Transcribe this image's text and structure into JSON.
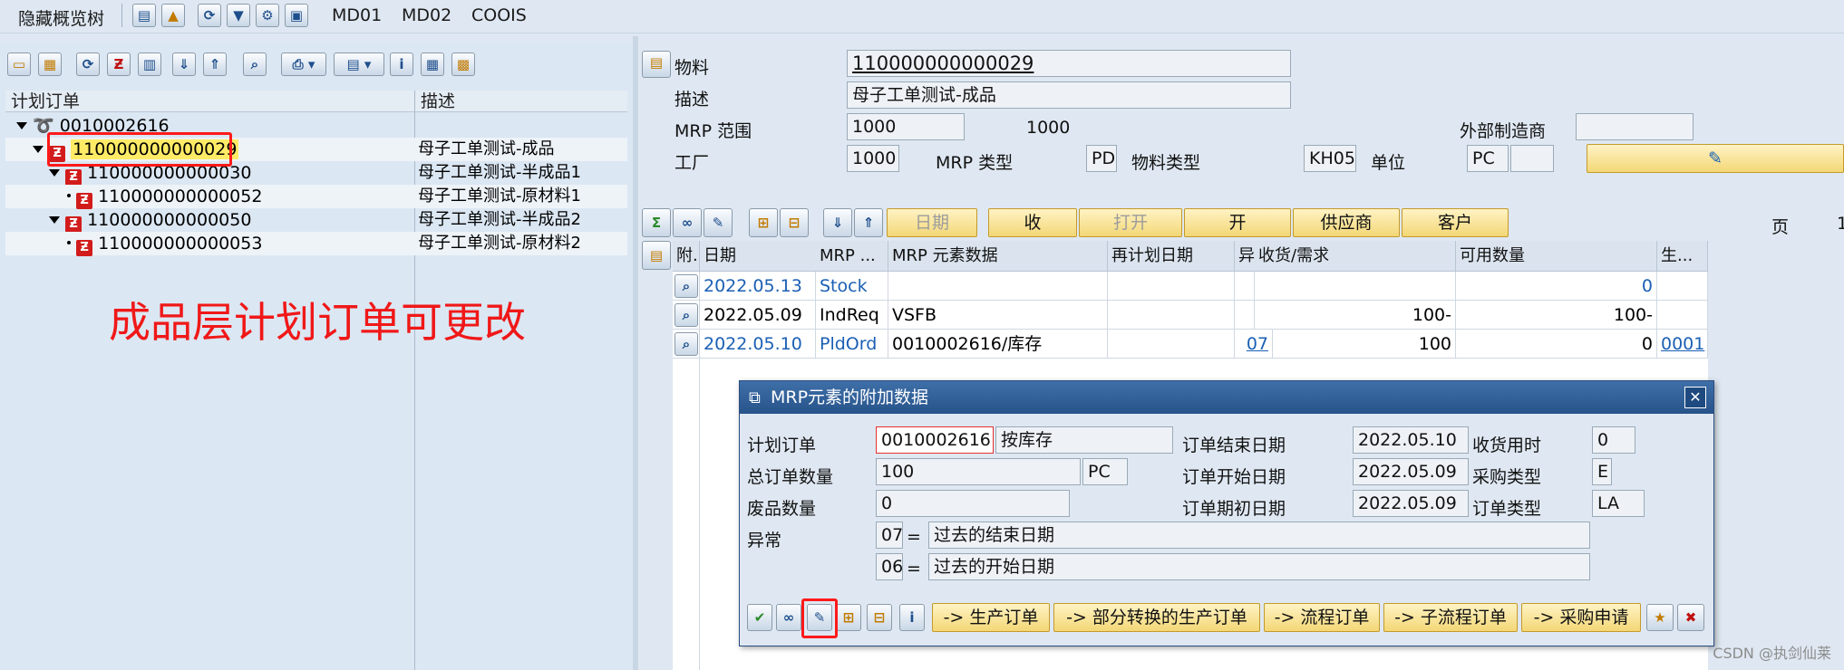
{
  "toolbar": {
    "hide_tree_label": "隐藏概览树",
    "md01_label": "MD01",
    "md02_label": "MD02",
    "coois_label": "COOIS"
  },
  "tree": {
    "col_order": "计划订单",
    "col_desc": "描述",
    "rows": [
      {
        "id": "0010002616",
        "desc": ""
      },
      {
        "id": "110000000000029",
        "desc": "母子工单测试-成品"
      },
      {
        "id": "110000000000030",
        "desc": "母子工单测试-半成品1"
      },
      {
        "id": "110000000000052",
        "desc": "母子工单测试-原材料1"
      },
      {
        "id": "110000000000050",
        "desc": "母子工单测试-半成品2"
      },
      {
        "id": "110000000000053",
        "desc": "母子工单测试-原材料2"
      }
    ],
    "annotation": "成品层计划订单可更改"
  },
  "header": {
    "material_label": "物料",
    "material_value": "110000000000029",
    "desc_label": "描述",
    "desc_value": "母子工单测试-成品",
    "mrp_area_label": "MRP 范围",
    "mrp_area_value": "1000",
    "mrp_area_text": "1000",
    "ext_mfr_label": "外部制造商",
    "ext_mfr_value": "",
    "plant_label": "工厂",
    "plant_value": "1000",
    "mrp_type_label": "MRP 类型",
    "mrp_type_value": "PD",
    "mat_type_label": "物料类型",
    "mat_type_value": "KH05",
    "unit_label": "单位",
    "unit_value": "PC"
  },
  "actions": {
    "date_btn": "日期",
    "receipt_btn": "收",
    "open_btn": "打开",
    "open2_btn": "开",
    "vendor_btn": "供应商",
    "customer_btn": "客户",
    "page_label": "页",
    "page_value": "1"
  },
  "grid": {
    "headers": [
      "附.",
      "日期",
      "MRP ...",
      "MRP 元素数据",
      "再计划日期",
      "异.",
      "收货/需求",
      "可用数量",
      "生..."
    ],
    "rows": [
      {
        "date": "2022.05.13",
        "mrp": "Stock",
        "data": "",
        "resched": "",
        "exc": "",
        "qty": "",
        "avail": "0",
        "prod": ""
      },
      {
        "date": "2022.05.09",
        "mrp": "IndReq",
        "data": "VSFB",
        "resched": "",
        "exc": "",
        "qty": "100-",
        "avail": "100-",
        "prod": ""
      },
      {
        "date": "2022.05.10",
        "mrp": "PldOrd",
        "data": "0010002616/库存",
        "resched": "",
        "exc": "07",
        "qty": "100",
        "avail": "0",
        "prod": "0001"
      }
    ]
  },
  "dialog": {
    "title": "MRP元素的附加数据",
    "planned_order_label": "计划订单",
    "planned_order_value": "0010002616",
    "planned_order_text": "按库存",
    "total_qty_label": "总订单数量",
    "total_qty_value": "100",
    "total_qty_unit": "PC",
    "scrap_label": "废品数量",
    "scrap_value": "0",
    "exception_label": "异常",
    "exc1_code": "07",
    "exc1_eq": "=",
    "exc1_text": "过去的结束日期",
    "exc2_code": "06",
    "exc2_eq": "=",
    "exc2_text": "过去的开始日期",
    "end_date_label": "订单结束日期",
    "end_date_value": "2022.05.10",
    "start_date_label": "订单开始日期",
    "start_date_value": "2022.05.09",
    "opening_date_label": "订单期初日期",
    "opening_date_value": "2022.05.09",
    "gr_time_label": "收货用时",
    "gr_time_value": "0",
    "proc_type_label": "采购类型",
    "proc_type_value": "E",
    "order_type_label": "订单类型",
    "order_type_value": "LA",
    "btn_prod_order": "-> 生产订单",
    "btn_partial": "-> 部分转换的生产订单",
    "btn_process": "-> 流程订单",
    "btn_subprocess": "-> 子流程订单",
    "btn_purch_req": "-> 采购申请"
  },
  "watermark": "CSDN @执剑仙莱"
}
